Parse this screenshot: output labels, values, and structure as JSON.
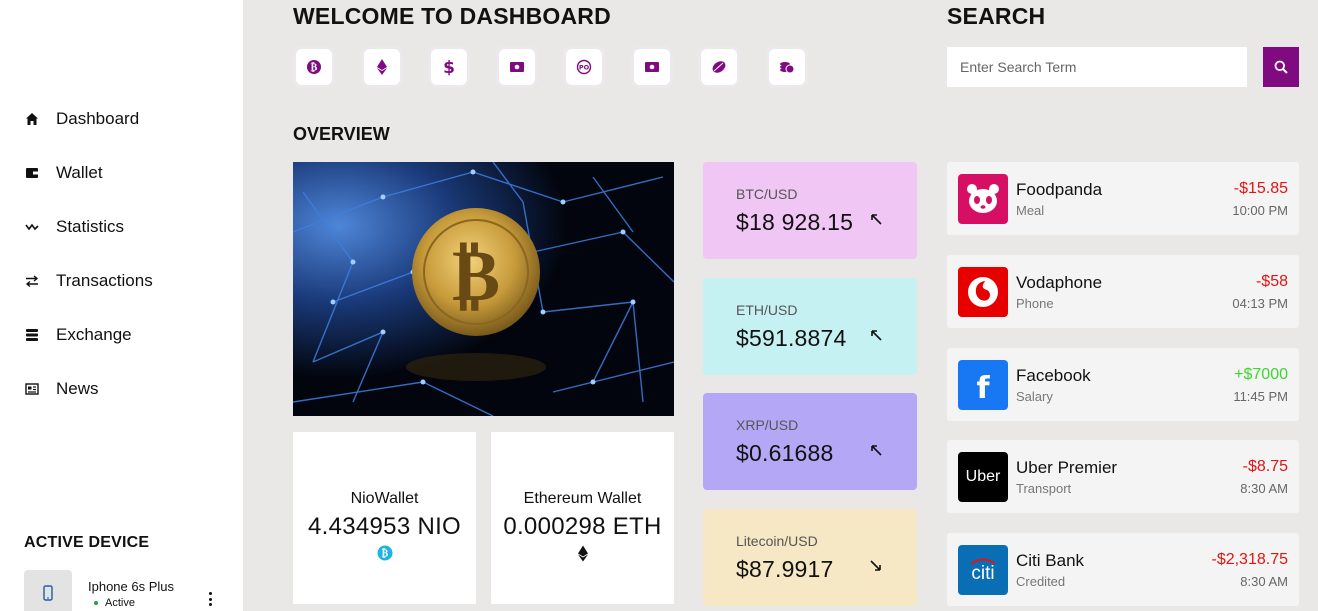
{
  "sidebar": {
    "nav": [
      {
        "label": "Dashboard",
        "icon": "home-icon"
      },
      {
        "label": "Wallet",
        "icon": "wallet-icon"
      },
      {
        "label": "Statistics",
        "icon": "statistics-icon"
      },
      {
        "label": "Transactions",
        "icon": "transactions-icon"
      },
      {
        "label": "Exchange",
        "icon": "exchange-icon"
      },
      {
        "label": "News",
        "icon": "news-icon"
      }
    ],
    "active_device": {
      "title": "ACTIVE DEVICE",
      "name": "Iphone 6s Plus",
      "status": "Active",
      "icon": "phone-icon"
    }
  },
  "main": {
    "title": "WELCOME TO DASHBOARD",
    "coins": [
      "bitcoin-icon",
      "ethereum-icon",
      "dollar-icon",
      "cash-icon",
      "payoneer-icon",
      "money-icon",
      "leaf-coin-icon",
      "coin-stack-icon"
    ],
    "overview_title": "OVERVIEW",
    "wallets": [
      {
        "name": "NioWallet",
        "value": "4.434953 NIO",
        "icon": "bitcoin-icon"
      },
      {
        "name": "Ethereum Wallet",
        "value": "0.000298 ETH",
        "icon": "ethereum-icon"
      }
    ],
    "rates": [
      {
        "pair": "BTC/USD",
        "price": "$18 928.15",
        "trend": "up",
        "color": "#f0c6f4"
      },
      {
        "pair": "ETH/USD",
        "price": "$591.8874",
        "trend": "up",
        "color": "#c6f1f2"
      },
      {
        "pair": "XRP/USD",
        "price": "$0.61688",
        "trend": "up",
        "color": "#b4a8f6"
      },
      {
        "pair": "Litecoin/USD",
        "price": "$87.9917",
        "trend": "down",
        "color": "#f6e8c4"
      }
    ]
  },
  "search": {
    "title": "SEARCH",
    "placeholder": "Enter Search Term"
  },
  "transactions": [
    {
      "name": "Foodpanda",
      "category": "Meal",
      "amount": "-$15.85",
      "time": "10:00 PM",
      "color": "#e31414",
      "logo": "foodpanda-icon",
      "logo_bg": "#d70f64"
    },
    {
      "name": "Vodaphone",
      "category": "Phone",
      "amount": "-$58",
      "time": "04:13 PM",
      "color": "#e31414",
      "logo": "vodafone-icon",
      "logo_bg": "#e60000"
    },
    {
      "name": "Facebook",
      "category": "Salary",
      "amount": "+$7000",
      "time": "11:45 PM",
      "color": "#3dd62e",
      "logo": "facebook-icon",
      "logo_bg": "#1877f2"
    },
    {
      "name": "Uber Premier",
      "category": "Transport",
      "amount": "-$8.75",
      "time": "8:30 AM",
      "color": "#e31414",
      "logo": "uber-icon",
      "logo_bg": "#000000",
      "logo_text": "Uber"
    },
    {
      "name": "Citi Bank",
      "category": "Credited",
      "amount": "-$2,318.75",
      "time": "8:30 AM",
      "color": "#e31414",
      "logo": "citi-icon",
      "logo_bg": "#0a6eb4",
      "logo_text": "citi"
    }
  ],
  "colors": {
    "accent": "#800a80",
    "background": "#e9e8e7"
  }
}
